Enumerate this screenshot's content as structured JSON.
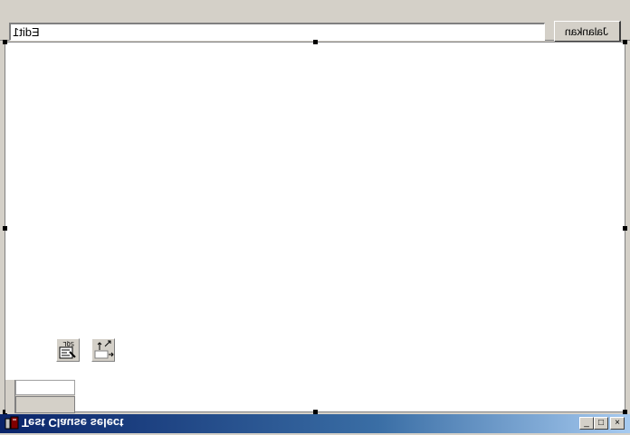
{
  "window": {
    "title": "Test Clause select",
    "controls": {
      "minimize": "_",
      "maximize": "□",
      "close": "×"
    }
  },
  "toolbar": {
    "edit_value": "Edit1",
    "button_label": "Jalankan"
  },
  "canvas": {
    "icons": [
      "sql-query-icon",
      "move-arrows-icon"
    ]
  },
  "colors": {
    "titlebar_start": "#0a246a",
    "titlebar_end": "#a6caf0",
    "face": "#d4d0c8",
    "canvas": "#ffffff"
  }
}
